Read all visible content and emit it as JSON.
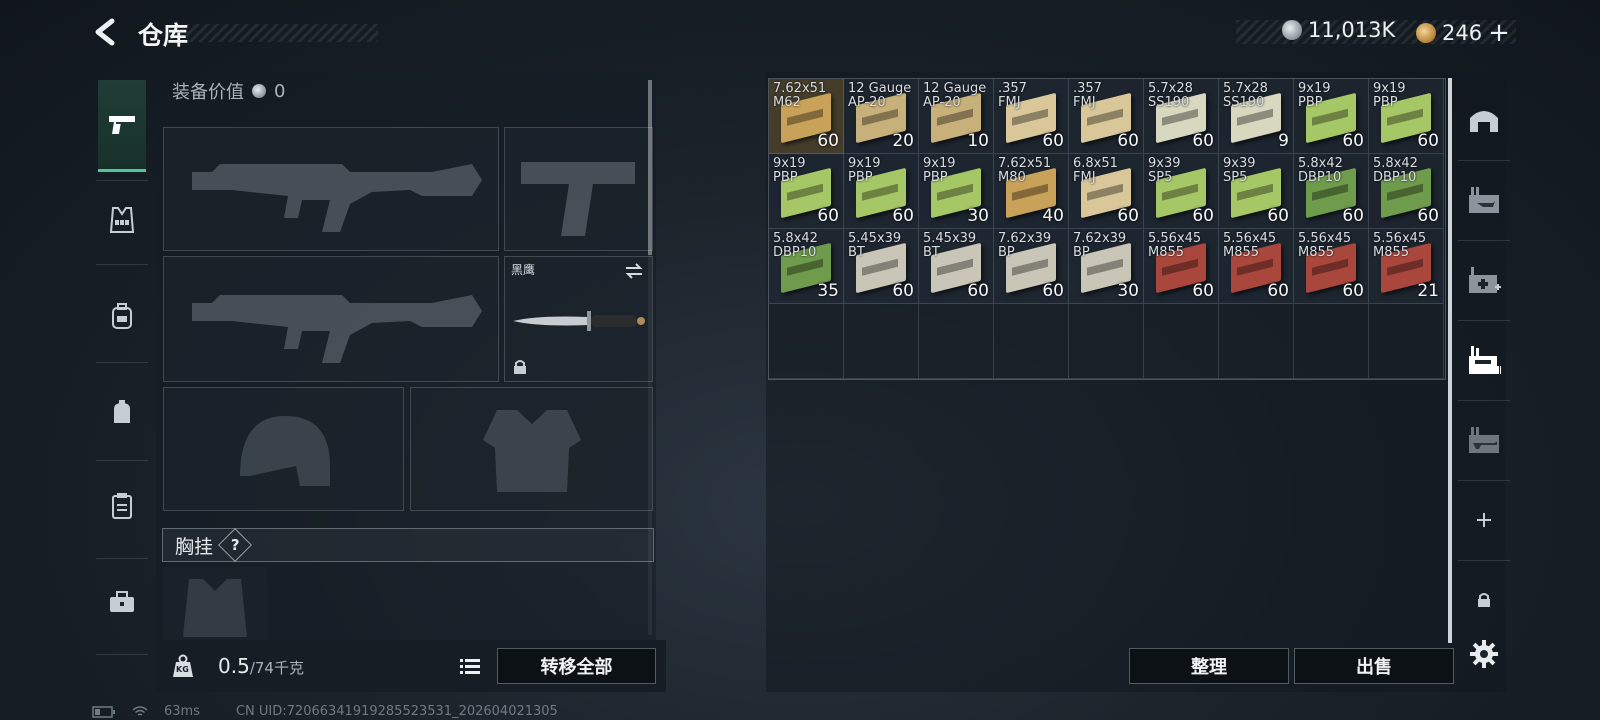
{
  "header": {
    "title": "仓库",
    "back_icon": "back-chevron-icon",
    "silver": "11,013K",
    "gold": "246",
    "add_symbol": "+",
    "colors": {
      "silver_coin": "#aab2ba",
      "gold_coin": "#c48f35"
    }
  },
  "rail": {
    "items": [
      {
        "icon": "pistol-icon",
        "active": true
      },
      {
        "icon": "vest-icon",
        "active": false
      },
      {
        "icon": "backpack-icon",
        "active": false
      },
      {
        "icon": "bag-icon",
        "active": false
      },
      {
        "icon": "clipboard-icon",
        "active": false
      },
      {
        "icon": "toolbox-icon",
        "active": false
      }
    ]
  },
  "equipment": {
    "value_label": "装备价值",
    "value": "0",
    "knife_name": "黑鹰",
    "chest_label": "胸挂",
    "help_symbol": "?",
    "weight": "0.5",
    "capacity": "/74千克",
    "weight_icon_label": "KG",
    "transfer_all": "转移全部"
  },
  "warehouse": {
    "items": [
      {
        "name": "7.62x51\nM62",
        "qty": "60",
        "color": "#c9a25a",
        "selected": true
      },
      {
        "name": "12 Gauge\nAP-20",
        "qty": "20",
        "color": "#c8b07a"
      },
      {
        "name": "12 Gauge\nAP-20",
        "qty": "10",
        "color": "#c8b07a"
      },
      {
        "name": ".357\nFMJ",
        "qty": "60",
        "color": "#d9c79a"
      },
      {
        "name": ".357\nFMJ",
        "qty": "60",
        "color": "#d9c79a"
      },
      {
        "name": "5.7x28\nSS190",
        "qty": "60",
        "color": "#d8d7c0"
      },
      {
        "name": "5.7x28\nSS190",
        "qty": "9",
        "color": "#d8d7c0"
      },
      {
        "name": "9x19\nPBP",
        "qty": "60",
        "color": "#a6c766"
      },
      {
        "name": "9x19\nPBP",
        "qty": "60",
        "color": "#a6c766"
      },
      {
        "name": "9x19\nPBP",
        "qty": "60",
        "color": "#a6c766"
      },
      {
        "name": "9x19\nPBP",
        "qty": "60",
        "color": "#a6c766"
      },
      {
        "name": "9x19\nPBP",
        "qty": "30",
        "color": "#a6c766"
      },
      {
        "name": "7.62x51\nM80",
        "qty": "40",
        "color": "#c9a25a"
      },
      {
        "name": "6.8x51\nFMJ",
        "qty": "60",
        "color": "#d9c79a"
      },
      {
        "name": "9x39\nSP5",
        "qty": "60",
        "color": "#a6c766"
      },
      {
        "name": "9x39\nSP5",
        "qty": "60",
        "color": "#a6c766"
      },
      {
        "name": "5.8x42\nDBP10",
        "qty": "60",
        "color": "#6f9b4c"
      },
      {
        "name": "5.8x42\nDBP10",
        "qty": "60",
        "color": "#6f9b4c"
      },
      {
        "name": "5.8x42\nDBP10",
        "qty": "35",
        "color": "#6f9b4c"
      },
      {
        "name": "5.45x39\nBT",
        "qty": "60",
        "color": "#c9c6b8"
      },
      {
        "name": "5.45x39\nBT",
        "qty": "60",
        "color": "#c9c6b8"
      },
      {
        "name": "7.62x39\nBP",
        "qty": "60",
        "color": "#c9c6b8"
      },
      {
        "name": "7.62x39\nBP",
        "qty": "30",
        "color": "#c9c6b8"
      },
      {
        "name": "5.56x45\nM855",
        "qty": "60",
        "color": "#a9473d"
      },
      {
        "name": "5.56x45\nM855",
        "qty": "60",
        "color": "#a9473d"
      },
      {
        "name": "5.56x45\nM855",
        "qty": "60",
        "color": "#a9473d"
      },
      {
        "name": "5.56x45\nM855",
        "qty": "21",
        "color": "#a9473d"
      }
    ],
    "empty_slots": 9,
    "sort": "整理",
    "sell": "出售"
  },
  "right_rail": {
    "items": [
      {
        "icon": "bunker-icon"
      },
      {
        "icon": "weapon-case-icon"
      },
      {
        "icon": "medical-case-icon"
      },
      {
        "icon": "ammo-case-icon"
      },
      {
        "icon": "rifle-case-icon"
      },
      {
        "icon": "add-icon"
      },
      {
        "icon": "lock-icon"
      }
    ]
  },
  "footer": {
    "ping": "63ms",
    "uid": "CN UID:72066341919285523531_202604021305"
  }
}
